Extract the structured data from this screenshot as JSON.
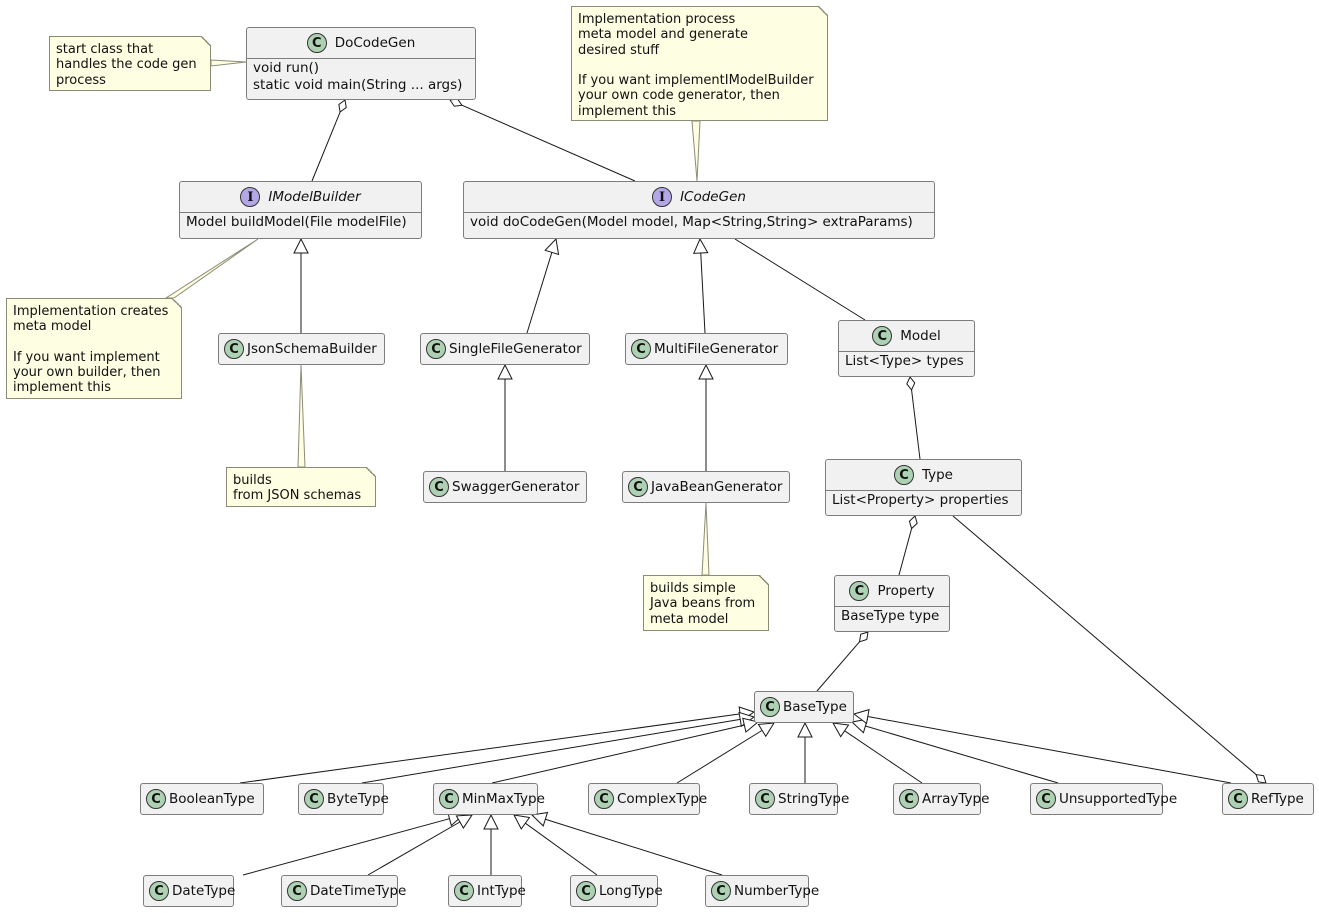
{
  "diagram": {
    "type": "uml-class-diagram",
    "classes": [
      {
        "id": "DoCodeGen",
        "kind": "class",
        "name": "DoCodeGen",
        "members": [
          "void run()",
          "static void main(String ... args)"
        ]
      },
      {
        "id": "IModelBuilder",
        "kind": "interface",
        "name": "IModelBuilder",
        "members": [
          "Model buildModel(File modelFile)"
        ]
      },
      {
        "id": "ICodeGen",
        "kind": "interface",
        "name": "ICodeGen",
        "members": [
          "void doCodeGen(Model model, Map<String,String> extraParams)"
        ]
      },
      {
        "id": "JsonSchemaBuilder",
        "kind": "class",
        "name": "JsonSchemaBuilder",
        "members": []
      },
      {
        "id": "SingleFileGenerator",
        "kind": "class",
        "name": "SingleFileGenerator",
        "members": []
      },
      {
        "id": "MultiFileGenerator",
        "kind": "class",
        "name": "MultiFileGenerator",
        "members": []
      },
      {
        "id": "Model",
        "kind": "class",
        "name": "Model",
        "members": [
          "List<Type> types"
        ]
      },
      {
        "id": "SwaggerGenerator",
        "kind": "class",
        "name": "SwaggerGenerator",
        "members": []
      },
      {
        "id": "JavaBeanGenerator",
        "kind": "class",
        "name": "JavaBeanGenerator",
        "members": []
      },
      {
        "id": "Type",
        "kind": "class",
        "name": "Type",
        "members": [
          "List<Property> properties"
        ]
      },
      {
        "id": "Property",
        "kind": "class",
        "name": "Property",
        "members": [
          "BaseType type"
        ]
      },
      {
        "id": "BaseType",
        "kind": "class",
        "name": "BaseType",
        "members": []
      },
      {
        "id": "BooleanType",
        "kind": "class",
        "name": "BooleanType",
        "members": []
      },
      {
        "id": "ByteType",
        "kind": "class",
        "name": "ByteType",
        "members": []
      },
      {
        "id": "MinMaxType",
        "kind": "class",
        "name": "MinMaxType",
        "members": []
      },
      {
        "id": "ComplexType",
        "kind": "class",
        "name": "ComplexType",
        "members": []
      },
      {
        "id": "StringType",
        "kind": "class",
        "name": "StringType",
        "members": []
      },
      {
        "id": "ArrayType",
        "kind": "class",
        "name": "ArrayType",
        "members": []
      },
      {
        "id": "UnsupportedType",
        "kind": "class",
        "name": "UnsupportedType",
        "members": []
      },
      {
        "id": "RefType",
        "kind": "class",
        "name": "RefType",
        "members": []
      },
      {
        "id": "DateType",
        "kind": "class",
        "name": "DateType",
        "members": []
      },
      {
        "id": "DateTimeType",
        "kind": "class",
        "name": "DateTimeType",
        "members": []
      },
      {
        "id": "IntType",
        "kind": "class",
        "name": "IntType",
        "members": []
      },
      {
        "id": "LongType",
        "kind": "class",
        "name": "LongType",
        "members": []
      },
      {
        "id": "NumberType",
        "kind": "class",
        "name": "NumberType",
        "members": []
      }
    ],
    "notes": [
      {
        "id": "note-docodegen",
        "attached_to": "DoCodeGen",
        "text": "start class that\nhandles the code gen\nprocess"
      },
      {
        "id": "note-icodegen",
        "attached_to": "ICodeGen",
        "text": "Implementation process\nmeta model and generate\ndesired stuff\n\nIf you want implementIModelBuilder\nyour own code generator, then\nimplement this"
      },
      {
        "id": "note-imodelbuilder",
        "attached_to": "IModelBuilder",
        "text": "Implementation creates\nmeta model\n\nIf you want implement\nyour own builder, then\nimplement this"
      },
      {
        "id": "note-jsonschemabuilder",
        "attached_to": "JsonSchemaBuilder",
        "text": "builds\nfrom JSON schemas"
      },
      {
        "id": "note-javabeangenerator",
        "attached_to": "JavaBeanGenerator",
        "text": "builds simple\nJava beans from\nmeta model"
      }
    ],
    "relations": [
      {
        "type": "aggregation",
        "whole": "DoCodeGen",
        "part": "IModelBuilder"
      },
      {
        "type": "aggregation",
        "whole": "DoCodeGen",
        "part": "ICodeGen"
      },
      {
        "type": "inheritance",
        "parent": "IModelBuilder",
        "child": "JsonSchemaBuilder"
      },
      {
        "type": "inheritance",
        "parent": "ICodeGen",
        "child": "SingleFileGenerator"
      },
      {
        "type": "inheritance",
        "parent": "ICodeGen",
        "child": "MultiFileGenerator"
      },
      {
        "type": "association",
        "from": "ICodeGen",
        "to": "Model"
      },
      {
        "type": "inheritance",
        "parent": "SingleFileGenerator",
        "child": "SwaggerGenerator"
      },
      {
        "type": "inheritance",
        "parent": "MultiFileGenerator",
        "child": "JavaBeanGenerator"
      },
      {
        "type": "aggregation",
        "whole": "Model",
        "part": "Type"
      },
      {
        "type": "aggregation",
        "whole": "Type",
        "part": "Property"
      },
      {
        "type": "aggregation",
        "whole": "RefType",
        "part": "Type"
      },
      {
        "type": "aggregation",
        "whole": "Property",
        "part": "BaseType"
      },
      {
        "type": "inheritance",
        "parent": "BaseType",
        "child": "BooleanType"
      },
      {
        "type": "inheritance",
        "parent": "BaseType",
        "child": "ByteType"
      },
      {
        "type": "inheritance",
        "parent": "BaseType",
        "child": "MinMaxType"
      },
      {
        "type": "inheritance",
        "parent": "BaseType",
        "child": "ComplexType"
      },
      {
        "type": "inheritance",
        "parent": "BaseType",
        "child": "StringType"
      },
      {
        "type": "inheritance",
        "parent": "BaseType",
        "child": "ArrayType"
      },
      {
        "type": "inheritance",
        "parent": "BaseType",
        "child": "UnsupportedType"
      },
      {
        "type": "inheritance",
        "parent": "BaseType",
        "child": "RefType"
      },
      {
        "type": "inheritance",
        "parent": "MinMaxType",
        "child": "DateType"
      },
      {
        "type": "inheritance",
        "parent": "MinMaxType",
        "child": "DateTimeType"
      },
      {
        "type": "inheritance",
        "parent": "MinMaxType",
        "child": "IntType"
      },
      {
        "type": "inheritance",
        "parent": "MinMaxType",
        "child": "LongType"
      },
      {
        "type": "inheritance",
        "parent": "MinMaxType",
        "child": "NumberType"
      }
    ],
    "badges": {
      "class": "C",
      "interface": "I"
    },
    "colors": {
      "class_fill": "#f1f1f1",
      "class_border": "#7d7d7d",
      "class_badge": "#add1b2",
      "interface_badge": "#b4a7e5",
      "note_fill": "#fefee2",
      "note_border": "#8c8c76",
      "edge": "#181818"
    }
  }
}
